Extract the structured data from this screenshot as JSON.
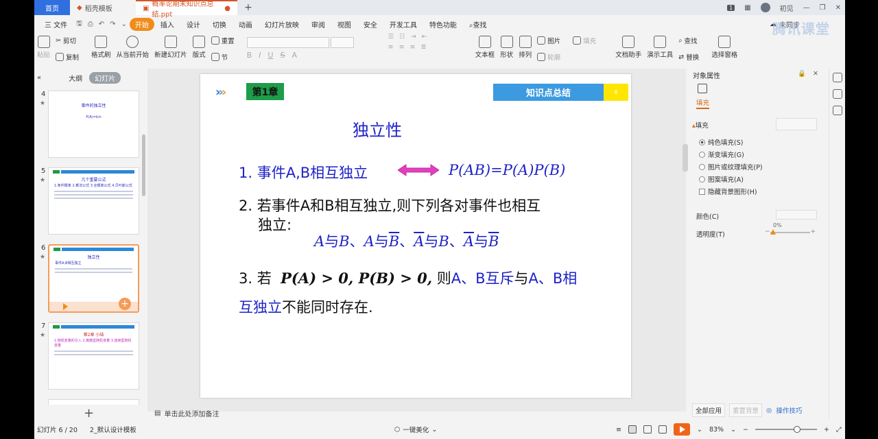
{
  "tabs": {
    "home": "首页",
    "template": "稻壳模板",
    "document": "概率论期末知识点总结.ppt",
    "plus": "+"
  },
  "titlebar": {
    "badge": "1",
    "user": "初见"
  },
  "menu": {
    "file": "三 文件",
    "items": [
      "开始",
      "插入",
      "设计",
      "切换",
      "动画",
      "幻灯片放映",
      "审阅",
      "视图",
      "安全",
      "开发工具",
      "特色功能"
    ],
    "active": "开始",
    "search": "查找",
    "sync": "未同步",
    "watermark": "腾讯课堂"
  },
  "ribbon": {
    "paste": "粘贴",
    "cut": "剪切",
    "copy": "复制",
    "format_painter": "格式刷",
    "from_current": "从当前开始",
    "new_slide": "新建幻灯片",
    "layout": "版式",
    "reset": "重置",
    "section": "节",
    "textbox": "文本框",
    "shape": "形状",
    "arrange": "排列",
    "picture": "图片",
    "fill": "填充",
    "outline": "轮廓",
    "doc_assistant": "文档助手",
    "presentation_tools": "演示工具",
    "find": "查找",
    "replace": "替换",
    "select_pane": "选择窗格"
  },
  "leftpane": {
    "outline": "大纲",
    "slides": "幻灯片",
    "thumbs": [
      {
        "num": "4",
        "title": "事件的独立性",
        "text": "P(A)=k/n"
      },
      {
        "num": "5",
        "title": "几个重要公式",
        "text": "1.条件概率 2.乘法公式 3.全概率公式 4.贝叶斯公式"
      },
      {
        "num": "6",
        "title": "独立性",
        "text": "事件A,B相互独立"
      },
      {
        "num": "7",
        "title": "第2章 小结",
        "text": "1.随机变量的引入 2.离散型随机变量 3.连续型随机变量"
      }
    ],
    "add": "+"
  },
  "slide": {
    "chapter": "第1章",
    "topic": "知识点总结",
    "page": "6",
    "title": "独立性",
    "item1": "1. 事件A,B相互独立",
    "formula1": "P(AB)=P(A)P(B)",
    "item2a": "2.  若事件A和B相互独立,则下列各对事件也相互",
    "item2b": "独立:",
    "pairs": {
      "p1a": "A",
      "p1b": "B",
      "p2a": "A",
      "p2b": "B",
      "p3a": "A",
      "p3b": "B",
      "p4a": "A",
      "p4b": "B",
      "conj": "与",
      "sep": "、"
    },
    "item3": {
      "prefix": "3. 若",
      "cond": "P(A) > 0, P(B) > 0,",
      "then": " 则",
      "blue1": "A、B互斥",
      "mid": "与",
      "blue2": "A、B相"
    },
    "item4": {
      "blue": "互独立",
      "black": "不能同时存在."
    }
  },
  "notes": "单击此处添加备注",
  "rightpane": {
    "title": "对象属性",
    "tab": "填充",
    "fill_label": "填充",
    "options": [
      "纯色填充(S)",
      "渐变填充(G)",
      "图片或纹理填充(P)",
      "图案填充(A)"
    ],
    "hide_bg": "隐藏背景图形(H)",
    "color": "颜色(C)",
    "transparency": "透明度(T)",
    "transparency_value": "0%",
    "apply_all": "全部应用",
    "reset_bg": "重置背景",
    "tips": "操作技巧"
  },
  "status": {
    "slide_info": "幻灯片 6 / 20",
    "template": "2_默认设计模板",
    "beautify": "一键美化",
    "zoom": "83%"
  },
  "colors": {
    "accent": "#f08c1a",
    "slide_blue": "#1e22c8",
    "chapter_green": "#1e9c4a",
    "topic_blue": "#3b9ae0",
    "arrow_pink": "#e040c0"
  }
}
